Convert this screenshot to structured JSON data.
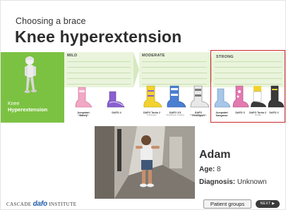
{
  "header": {
    "subtitle": "Choosing a brace",
    "title": "Knee hyperextension"
  },
  "condition_panel": {
    "label_line1": "Knee",
    "label_line2": "Hyperextension",
    "color": "#7cc242"
  },
  "columns": [
    {
      "heading": "MILD",
      "braces": [
        {
          "name": "Jumpstart Bunny",
          "sub": "Flexible Flap",
          "color": "#f1a8c4"
        },
        {
          "name": "DAFO 4",
          "sub": "",
          "color": "#8a5fd0"
        }
      ]
    },
    {
      "heading": "MODERATE",
      "braces": [
        {
          "name": "DAFO Turbo 2",
          "sub": "Full-length",
          "color": "#f2d22e"
        },
        {
          "name": "DAFO 3.5",
          "sub": "Dorsiflexion Limiting",
          "color": "#4b7fd1"
        },
        {
          "name": "DAFO FlexiSport",
          "sub": "Plantarflexion Stop",
          "color": "#7b7b7b"
        }
      ]
    },
    {
      "heading": "STRONG",
      "highlighted": true,
      "braces": [
        {
          "name": "Jumpstart Kangaroo",
          "sub": "",
          "color": "#a8c7e8"
        },
        {
          "name": "DAFO 3",
          "sub": "",
          "color": "#e27ab0"
        },
        {
          "name": "DAFO Turbo 2",
          "sub": "Tri-Flap",
          "color": "#f2d22e"
        },
        {
          "name": "DAFO 2",
          "sub": "",
          "color": "#3a3a3a"
        }
      ]
    }
  ],
  "patient": {
    "name": "Adam",
    "age_label": "Age:",
    "age_value": "8",
    "diagnosis_label": "Diagnosis:",
    "diagnosis_value": "Unknown"
  },
  "footer": {
    "logo_prefix": "CASCADE",
    "logo_brand": "dafo",
    "logo_suffix": "INSTITUTE",
    "patient_groups_label": "Patient groups",
    "next_label": "NEXT ▶"
  },
  "colors": {
    "highlight_border": "#c9282d",
    "header_band": "#eaf4dc"
  }
}
